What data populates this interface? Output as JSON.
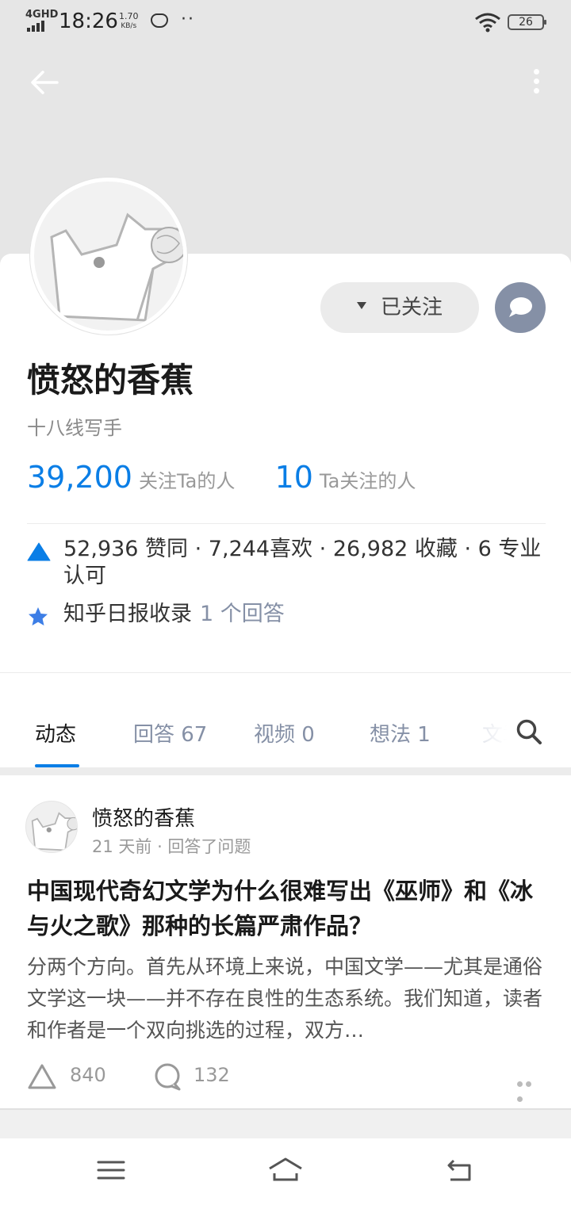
{
  "status_bar": {
    "network": "4GHD",
    "time": "18:26",
    "speed_value": "1.70",
    "speed_unit": "KB/s",
    "battery": "26"
  },
  "header": {
    "back_icon": "arrow-left-icon",
    "more_icon": "vertical-dots-icon",
    "background_color": "#e6e6e6"
  },
  "profile": {
    "name": "愤怒的香蕉",
    "headline": "十八线写手",
    "follow_button_label": "已关注",
    "followers_count": "39,200",
    "followers_label": "关注Ta的人",
    "following_count": "10",
    "following_label": "Ta关注的人",
    "achievements": "52,936 赞同 · 7,244喜欢 · 26,982 收藏 · 6 专业认可",
    "daily_label": "知乎日报收录",
    "daily_link": "1 个回答",
    "accent_color": "#0a7ee6"
  },
  "tabs": [
    {
      "label": "动态"
    },
    {
      "label": "回答 67"
    },
    {
      "label": "视频 0"
    },
    {
      "label": "想法 1"
    },
    {
      "label": "文章"
    }
  ],
  "feed": {
    "author": "愤怒的香蕉",
    "meta": "21 天前 · 回答了问题",
    "title": "中国现代奇幻文学为什么很难写出《巫师》和《冰与火之歌》那种的长篇严肃作品？",
    "excerpt": "分两个方向。首先从环境上来说，中国文学——尤其是通俗文学这一块——并不存在良性的生态系统。我们知道，读者和作者是一个双向挑选的过程，双方…",
    "votes": "840",
    "comments": "132"
  }
}
